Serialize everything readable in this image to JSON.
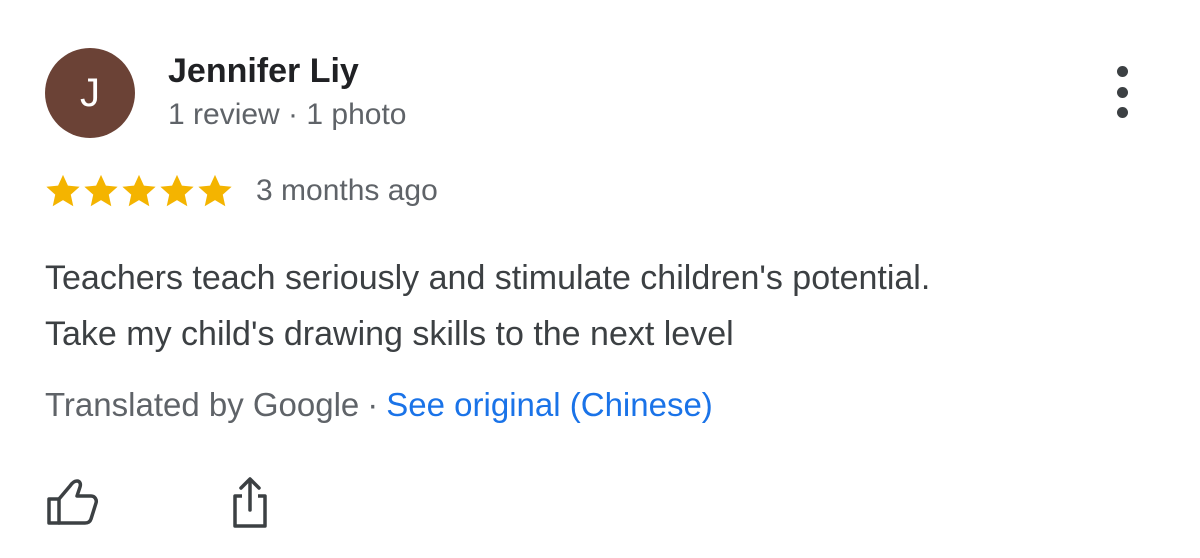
{
  "author": {
    "initial": "J",
    "name": "Jennifer Liy",
    "meta": "1 review · 1 photo",
    "avatar_color": "#6b4236"
  },
  "rating": {
    "stars": 5,
    "max_stars": 5,
    "star_color": "#f4b400",
    "time": "3 months ago"
  },
  "review": {
    "lines": [
      "Teachers teach seriously and stimulate children's potential.",
      "Take my child's drawing skills to the next level"
    ]
  },
  "translation": {
    "label": "Translated by Google",
    "separator": "·",
    "link": "See original (Chinese)",
    "link_color": "#1a73e8"
  },
  "actions": {
    "more_icon": "more-vert-icon",
    "like_icon": "thumbs-up-icon",
    "share_icon": "share-icon"
  }
}
